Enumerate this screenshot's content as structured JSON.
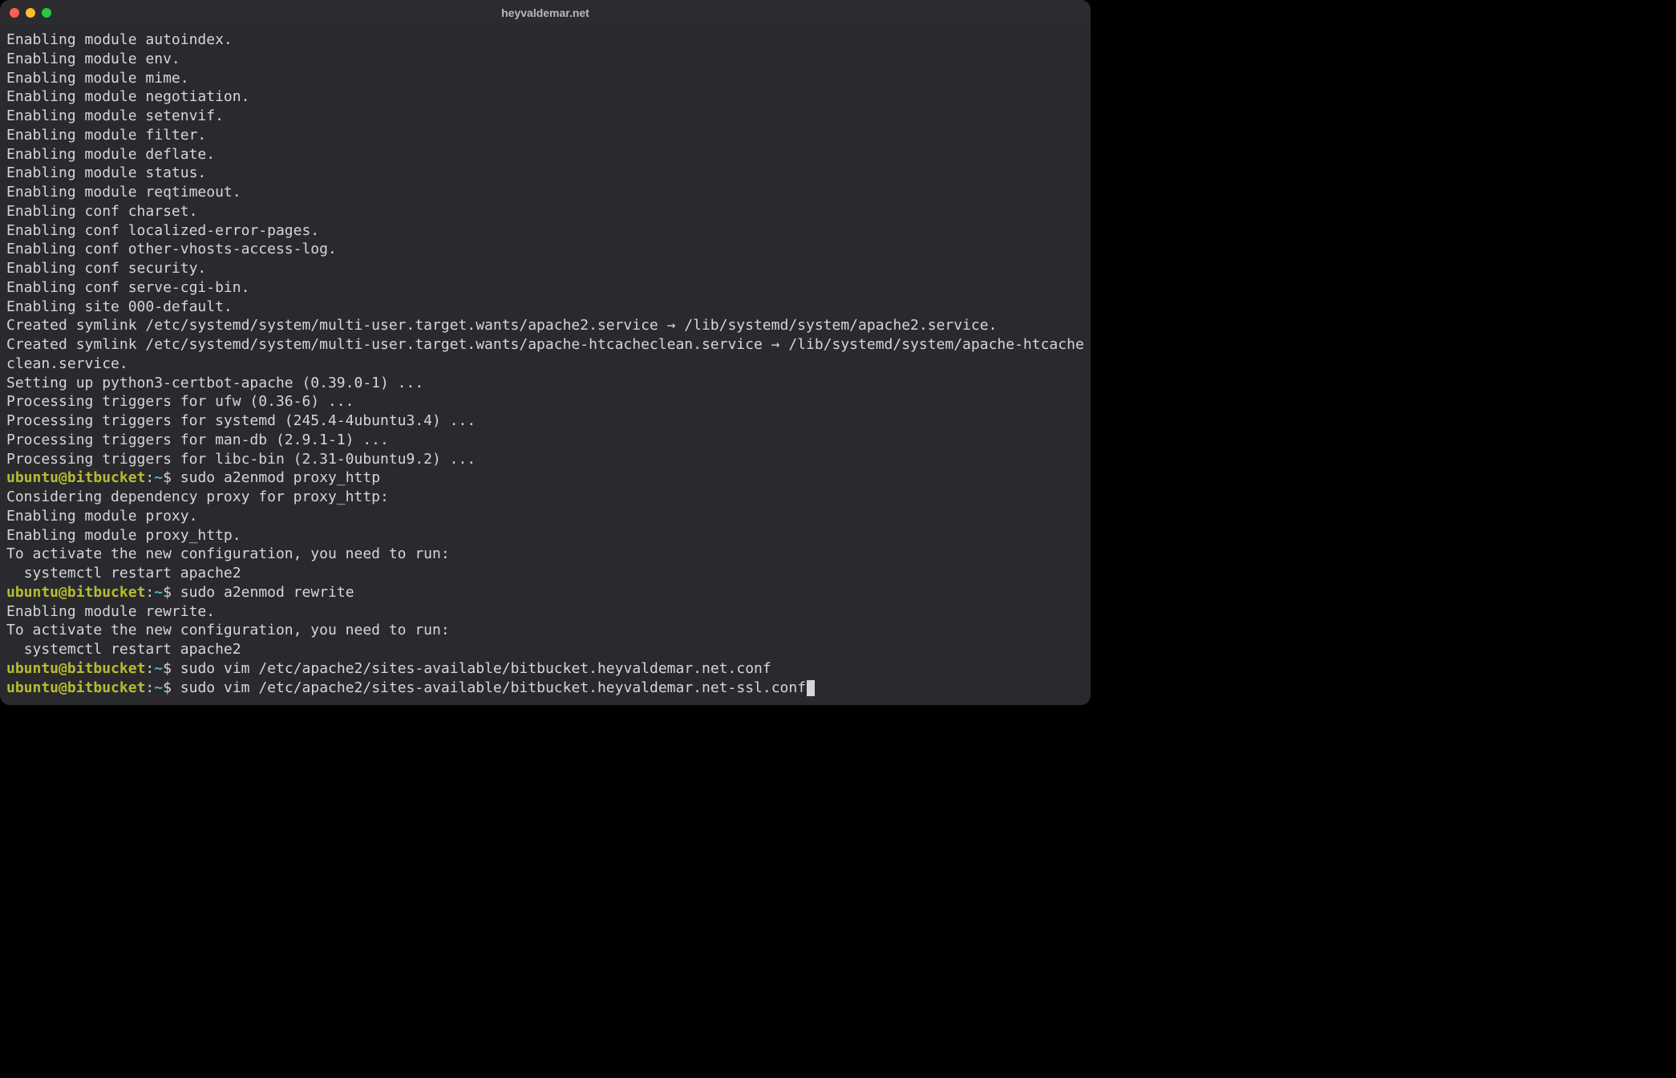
{
  "window": {
    "title": "heyvaldemar.net"
  },
  "prompt": {
    "user": "ubuntu",
    "at": "@",
    "host": "bitbucket",
    "colon": ":",
    "path": "~",
    "dollar": "$"
  },
  "output": {
    "lines": [
      "Enabling module autoindex.",
      "Enabling module env.",
      "Enabling module mime.",
      "Enabling module negotiation.",
      "Enabling module setenvif.",
      "Enabling module filter.",
      "Enabling module deflate.",
      "Enabling module status.",
      "Enabling module reqtimeout.",
      "Enabling conf charset.",
      "Enabling conf localized-error-pages.",
      "Enabling conf other-vhosts-access-log.",
      "Enabling conf security.",
      "Enabling conf serve-cgi-bin.",
      "Enabling site 000-default.",
      "Created symlink /etc/systemd/system/multi-user.target.wants/apache2.service → /lib/systemd/system/apache2.service.",
      "Created symlink /etc/systemd/system/multi-user.target.wants/apache-htcacheclean.service → /lib/systemd/system/apache-htcacheclean.service.",
      "Setting up python3-certbot-apache (0.39.0-1) ...",
      "Processing triggers for ufw (0.36-6) ...",
      "Processing triggers for systemd (245.4-4ubuntu3.4) ...",
      "Processing triggers for man-db (2.9.1-1) ...",
      "Processing triggers for libc-bin (2.31-0ubuntu9.2) ..."
    ]
  },
  "commands": {
    "c1": "sudo a2enmod proxy_http",
    "c1_out": [
      "Considering dependency proxy for proxy_http:",
      "Enabling module proxy.",
      "Enabling module proxy_http.",
      "To activate the new configuration, you need to run:",
      "  systemctl restart apache2"
    ],
    "c2": "sudo a2enmod rewrite",
    "c2_out": [
      "Enabling module rewrite.",
      "To activate the new configuration, you need to run:",
      "  systemctl restart apache2"
    ],
    "c3": "sudo vim /etc/apache2/sites-available/bitbucket.heyvaldemar.net.conf",
    "c4": "sudo vim /etc/apache2/sites-available/bitbucket.heyvaldemar.net-ssl.conf"
  }
}
